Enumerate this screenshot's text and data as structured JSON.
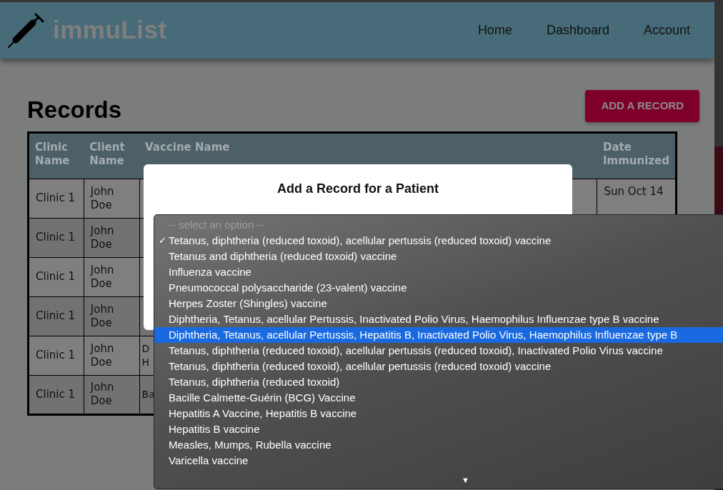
{
  "navbar": {
    "brand": "immuList",
    "links": [
      {
        "label": "Home"
      },
      {
        "label": "Dashboard"
      },
      {
        "label": "Account"
      }
    ]
  },
  "page": {
    "title": "Records",
    "add_button": "ADD A RECORD"
  },
  "table": {
    "columns": [
      {
        "label": "Clinic Name"
      },
      {
        "label": "Client Name"
      },
      {
        "label": "Vaccine Name"
      },
      {
        "label": "Date Immunized"
      }
    ],
    "rows": [
      {
        "clinic": "Clinic 1",
        "client": "John Doe",
        "date": "Sun Oct 14"
      },
      {
        "clinic": "Clinic 1",
        "client": "John Doe"
      },
      {
        "clinic": "Clinic 1",
        "client": "John Doe"
      },
      {
        "clinic": "Clinic 1",
        "client": "John Doe"
      },
      {
        "clinic": "Clinic 1",
        "client": "John Doe",
        "vaccine": "D\nH"
      },
      {
        "clinic": "Clinic 1",
        "client": "John Doe",
        "vaccine": "Ba"
      }
    ]
  },
  "modal": {
    "title": "Add a Record for a Patient"
  },
  "dropdown": {
    "options": [
      {
        "label": "-- select an option --",
        "disabled": true,
        "checked": false,
        "highlighted": false
      },
      {
        "label": "Tetanus, diphtheria (reduced toxoid), acellular pertussis (reduced toxoid) vaccine",
        "disabled": false,
        "checked": true,
        "highlighted": false
      },
      {
        "label": "Tetanus and diphtheria (reduced toxoid) vaccine",
        "disabled": false,
        "checked": false,
        "highlighted": false
      },
      {
        "label": "Influenza vaccine",
        "disabled": false,
        "checked": false,
        "highlighted": false
      },
      {
        "label": "Pneumococcal polysaccharide (23-valent) vaccine",
        "disabled": false,
        "checked": false,
        "highlighted": false
      },
      {
        "label": "Herpes Zoster (Shingles) vaccine",
        "disabled": false,
        "checked": false,
        "highlighted": false
      },
      {
        "label": "Diphtheria, Tetanus, acellular Pertussis, Inactivated Polio Virus, Haemophilus Influenzae type B vaccine",
        "disabled": false,
        "checked": false,
        "highlighted": false
      },
      {
        "label": "Diphtheria, Tetanus, acellular Pertussis, Hepatitis B, Inactivated Polio Virus, Haemophilus Influenzae type B",
        "disabled": false,
        "checked": false,
        "highlighted": true
      },
      {
        "label": "Tetanus, diphtheria (reduced toxoid), acellular pertussis (reduced toxoid), Inactivated Polio Virus vaccine",
        "disabled": false,
        "checked": false,
        "highlighted": false
      },
      {
        "label": "Tetanus, diphtheria (reduced toxoid), acellular pertussis (reduced toxoid) vaccine",
        "disabled": false,
        "checked": false,
        "highlighted": false
      },
      {
        "label": "Tetanus, diphtheria (reduced toxoid)",
        "disabled": false,
        "checked": false,
        "highlighted": false
      },
      {
        "label": "Bacille Calmette-Guérin (BCG) Vaccine",
        "disabled": false,
        "checked": false,
        "highlighted": false
      },
      {
        "label": "Hepatitis A Vaccine, Hepatitis B vaccine",
        "disabled": false,
        "checked": false,
        "highlighted": false
      },
      {
        "label": "Hepatitis B vaccine",
        "disabled": false,
        "checked": false,
        "highlighted": false
      },
      {
        "label": "Measles, Mumps, Rubella vaccine",
        "disabled": false,
        "checked": false,
        "highlighted": false
      },
      {
        "label": "Varicella vaccine",
        "disabled": false,
        "checked": false,
        "highlighted": false
      }
    ],
    "check_mark": "✓",
    "scroll_arrow": "▼"
  }
}
